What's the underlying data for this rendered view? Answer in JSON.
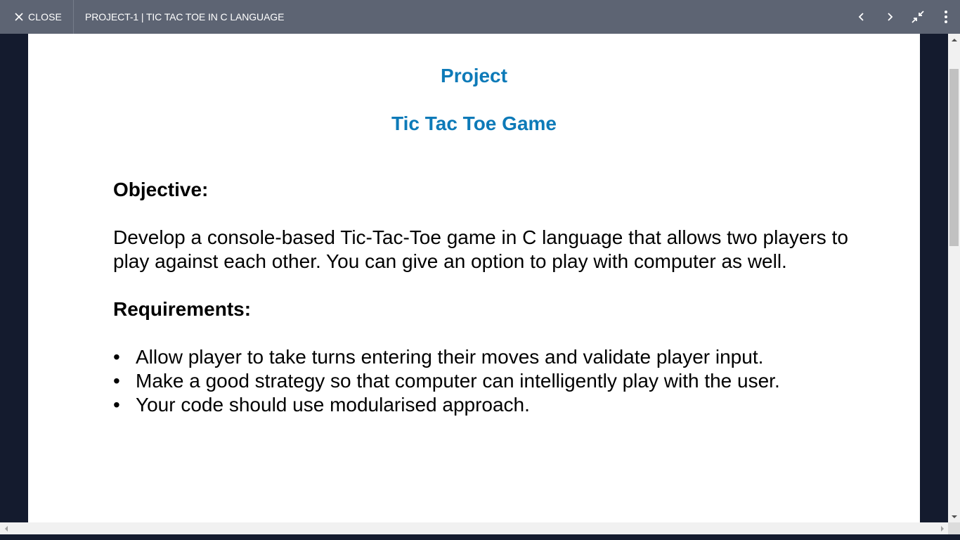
{
  "header": {
    "close_label": "CLOSE",
    "title": "PROJECT-1 | TIC TAC TOE IN C LANGUAGE",
    "icons": [
      "close-icon",
      "chevron-left-icon",
      "chevron-right-icon",
      "exit-fullscreen-icon",
      "more-vertical-icon"
    ],
    "background_color": "#5d6473"
  },
  "document": {
    "heading_1": "Project",
    "heading_2": "Tic Tac Toe Game",
    "heading_color": "#0d7ab8",
    "objective_heading": "Objective:",
    "objective_text": "Develop a console-based Tic-Tac-Toe game in C language that allows two players to play against each other. You can give an option to play with computer as well.",
    "requirements_heading": "Requirements:",
    "requirements": [
      "Allow player to take turns entering their moves and validate player input.",
      "Make a good strategy so that computer can intelligently play with the user.",
      "Your code should use modularised approach."
    ],
    "bullet_glyph": "•"
  }
}
